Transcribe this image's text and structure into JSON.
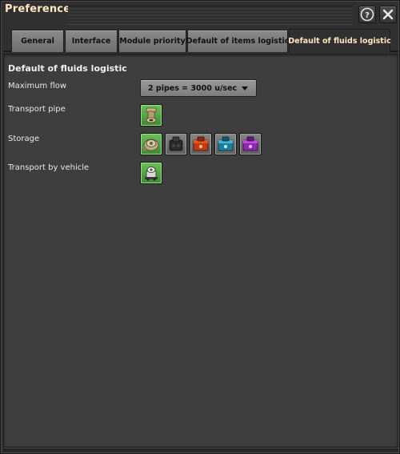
{
  "window": {
    "title": "Preferences",
    "help_icon": "question-mark-icon",
    "close_icon": "close-x-icon"
  },
  "tabs": [
    {
      "label": "General",
      "active": false
    },
    {
      "label": "Interface",
      "active": false
    },
    {
      "label": "Module priority",
      "active": false
    },
    {
      "label": "Default of items logistic",
      "active": false
    },
    {
      "label": "Default of fluids logistic",
      "active": true
    }
  ],
  "section": {
    "title": "Default of fluids logistic",
    "rows": {
      "max_flow": {
        "label": "Maximum flow",
        "selected": "2 pipes = 3000 u/sec"
      },
      "transport_pipe": {
        "label": "Transport pipe",
        "items": [
          {
            "icon": "pipe-icon",
            "selected": true
          }
        ]
      },
      "storage": {
        "label": "Storage",
        "items": [
          {
            "icon": "storage-tank-icon",
            "selected": true
          },
          {
            "icon": "dark-tank-icon",
            "selected": false
          },
          {
            "icon": "red-fluid-chest-icon",
            "selected": false
          },
          {
            "icon": "cyan-fluid-chest-icon",
            "selected": false
          },
          {
            "icon": "purple-fluid-chest-icon",
            "selected": false
          }
        ]
      },
      "vehicle": {
        "label": "Transport by vehicle",
        "items": [
          {
            "icon": "fluid-wagon-icon",
            "selected": true
          }
        ]
      }
    }
  },
  "colors": {
    "title_text": "#ffe6c0",
    "selected_slot": "#4fa542",
    "panel_bg": "#3e3e3e"
  }
}
